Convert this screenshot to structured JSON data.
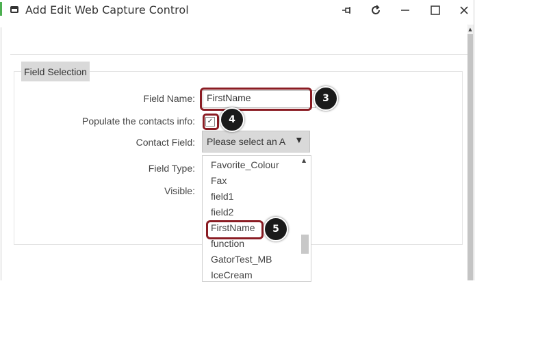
{
  "window": {
    "title": "Add Edit Web Capture Control"
  },
  "fieldset": {
    "legend": "Field Selection"
  },
  "form": {
    "field_name_label": "Field Name:",
    "field_name_value": "FirstName",
    "populate_label": "Populate the contacts info:",
    "populate_checked": "✓",
    "contact_field_label": "Contact Field:",
    "contact_field_selected": "Please select an A",
    "field_type_label": "Field Type:",
    "visible_label": "Visible:"
  },
  "dropdown": {
    "items": [
      "Favorite_Colour",
      "Fax",
      "field1",
      "field2",
      "FirstName",
      "function",
      "GatorTest_MB",
      "IceCream"
    ]
  },
  "badges": {
    "step3": "3",
    "step4": "4",
    "step5": "5"
  },
  "colors": {
    "highlight": "#8a1c23",
    "badge": "#1a1a1a"
  }
}
